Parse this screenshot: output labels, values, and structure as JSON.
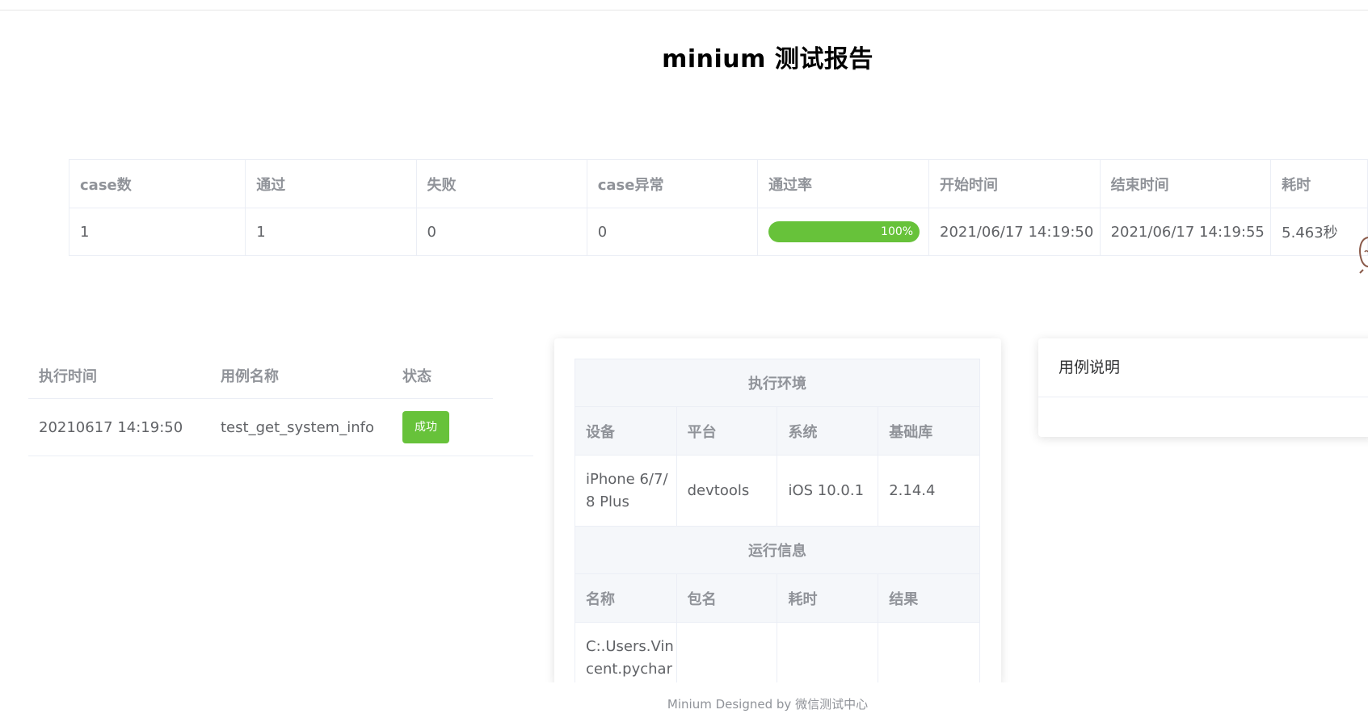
{
  "title": "minium 测试报告",
  "summary": {
    "headers": [
      "case数",
      "通过",
      "失败",
      "case异常",
      "通过率",
      "开始时间",
      "结束时间",
      "耗时"
    ],
    "values": {
      "case_count": "1",
      "passed": "1",
      "failed": "0",
      "error": "0",
      "pass_rate_label": "100%",
      "pass_rate": 1.0,
      "start_time": "2021/06/17 14:19:50",
      "end_time": "2021/06/17 14:19:55",
      "duration": "5.463秒"
    }
  },
  "case_list": {
    "headers": [
      "执行时间",
      "用例名称",
      "状态"
    ],
    "rows": [
      {
        "time": "20210617 14:19:50",
        "name": "test_get_system_info",
        "status": "成功"
      }
    ]
  },
  "environment": {
    "section_title": "执行环境",
    "headers": [
      "设备",
      "平台",
      "系统",
      "基础库"
    ],
    "values": [
      "iPhone 6/7/8 Plus",
      "devtools",
      "iOS 10.0.1",
      "2.14.4"
    ]
  },
  "run_info": {
    "section_title": "运行信息",
    "headers": [
      "名称",
      "包名",
      "耗时",
      "结果"
    ],
    "values": [
      "C:.Users.Vincent.pychar",
      "",
      "",
      ""
    ]
  },
  "description": {
    "title": "用例说明"
  },
  "footer": "Minium Designed by 微信测试中心",
  "colors": {
    "success": "#67c23a",
    "header_text": "#909399",
    "body_text": "#606266",
    "border": "#ebeef5"
  }
}
